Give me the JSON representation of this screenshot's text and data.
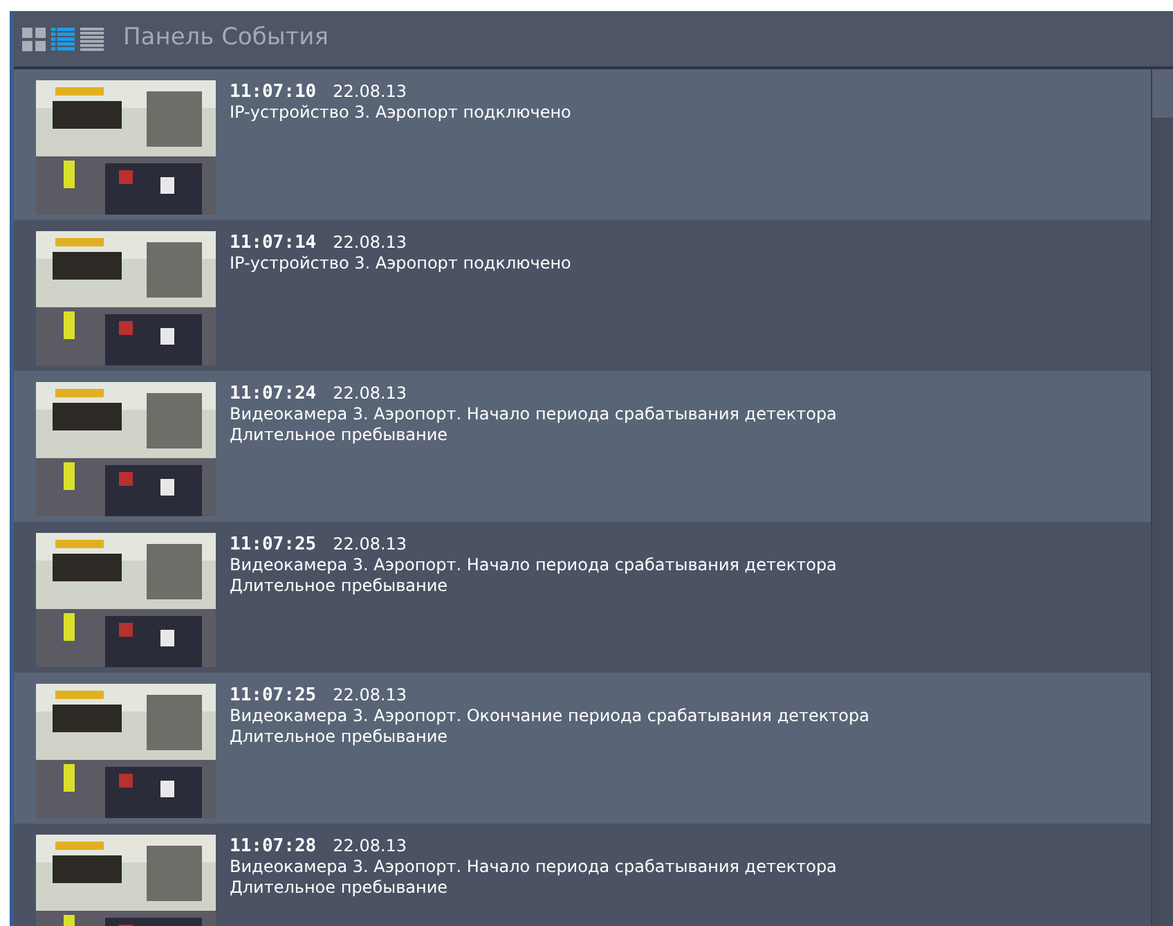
{
  "panel": {
    "title": "Панель События",
    "view_modes": [
      {
        "kind": "tiles",
        "selected": false
      },
      {
        "kind": "detailed",
        "selected": true
      },
      {
        "kind": "list",
        "selected": false
      }
    ]
  },
  "events": [
    {
      "time": "11:07:10",
      "date": "22.08.13",
      "lines": [
        "IP-устройство 3. Аэропорт подключено"
      ]
    },
    {
      "time": "11:07:14",
      "date": "22.08.13",
      "lines": [
        "IP-устройство 3. Аэропорт подключено"
      ]
    },
    {
      "time": "11:07:24",
      "date": "22.08.13",
      "lines": [
        "Видеокамера 3. Аэропорт. Начало периода срабатывания детектора",
        "Длительное пребывание"
      ]
    },
    {
      "time": "11:07:25",
      "date": "22.08.13",
      "lines": [
        "Видеокамера 3. Аэропорт. Начало периода срабатывания детектора",
        "Длительное пребывание"
      ]
    },
    {
      "time": "11:07:25",
      "date": "22.08.13",
      "lines": [
        "Видеокамера 3. Аэропорт. Окончание периода срабатывания детектора",
        "Длительное пребывание"
      ]
    },
    {
      "time": "11:07:28",
      "date": "22.08.13",
      "lines": [
        "Видеокамера 3. Аэропорт. Начало периода срабатывания детектора",
        "Длительное пребывание"
      ]
    }
  ]
}
